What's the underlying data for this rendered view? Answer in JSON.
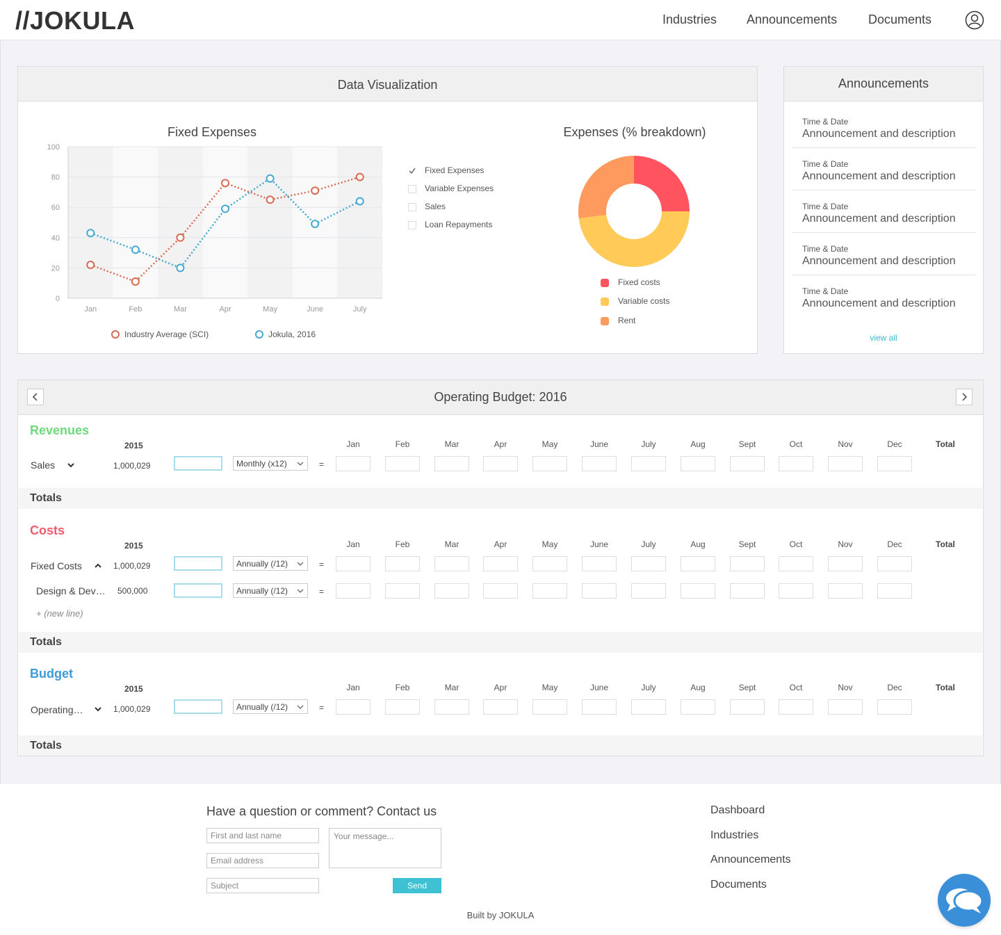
{
  "header": {
    "logo": "//JOKULA",
    "nav": [
      "Industries",
      "Announcements",
      "Documents"
    ],
    "user_icon": "user-circle-icon"
  },
  "dataviz": {
    "title": "Data Visualization",
    "line_chart": {
      "title": "Fixed Expenses",
      "legend": [
        "Industry Average (SCI)",
        "Jokula, 2016"
      ]
    },
    "filters": [
      {
        "label": "Fixed Expenses",
        "checked": true
      },
      {
        "label": "Variable Expenses",
        "checked": false
      },
      {
        "label": "Sales",
        "checked": false
      },
      {
        "label": "Loan Repayments",
        "checked": false
      }
    ],
    "donut": {
      "title": "Expenses (% breakdown)",
      "legend": [
        "Fixed costs",
        "Variable costs",
        "Rent"
      ]
    }
  },
  "chart_data": [
    {
      "type": "line",
      "title": "Fixed Expenses",
      "categories": [
        "Jan",
        "Feb",
        "Mar",
        "Apr",
        "May",
        "June",
        "July"
      ],
      "ylim": [
        0,
        100
      ],
      "yticks": [
        0,
        20,
        40,
        60,
        80,
        100
      ],
      "series": [
        {
          "name": "Industry Average (SCI)",
          "color": "#d86a52",
          "values": [
            22,
            11,
            40,
            76,
            65,
            71,
            80
          ]
        },
        {
          "name": "Jokula, 2016",
          "color": "#45a9cf",
          "values": [
            43,
            32,
            20,
            59,
            79,
            49,
            64
          ]
        }
      ],
      "grid": true,
      "legend": "bottom"
    },
    {
      "type": "pie",
      "title": "Expenses (% breakdown)",
      "labels": [
        "Fixed costs",
        "Variable costs",
        "Rent"
      ],
      "values": [
        25,
        48,
        27
      ],
      "colors": [
        "#ff5460",
        "#ffca58",
        "#ff9a5e"
      ],
      "legend": "bottom"
    }
  ],
  "announcements": {
    "title": "Announcements",
    "items": [
      {
        "time": "Time & Date",
        "desc": "Announcement and description"
      },
      {
        "time": "Time & Date",
        "desc": "Announcement and description"
      },
      {
        "time": "Time & Date",
        "desc": "Announcement and description"
      },
      {
        "time": "Time & Date",
        "desc": "Announcement and description"
      },
      {
        "time": "Time & Date",
        "desc": "Announcement and description"
      }
    ],
    "view_all": "view all"
  },
  "budget": {
    "title": "Operating Budget: 2016",
    "prev_icon": "chevron-left-icon",
    "next_icon": "chevron-right-icon",
    "months": [
      "Jan",
      "Feb",
      "Mar",
      "Apr",
      "May",
      "June",
      "July",
      "Aug",
      "Sept",
      "Oct",
      "Nov",
      "Dec"
    ],
    "total_label": "Total",
    "year": "2015",
    "totals_label": "Totals",
    "equals": "=",
    "sections": [
      {
        "title": "Revenues",
        "color": "#6ed97a",
        "rows": [
          {
            "name": "Sales",
            "value": "1,000,029",
            "freq": "Monthly (x12)"
          }
        ]
      },
      {
        "title": "Costs",
        "color": "#ef5b6b",
        "rows": [
          {
            "name": "Fixed Costs",
            "value": "1,000,029",
            "freq": "Annually (/12)"
          },
          {
            "name": "Design & Dev…",
            "value": "500,000",
            "freq": "Annually (/12)"
          }
        ],
        "new_line": "+ (new line)"
      },
      {
        "title": "Budget",
        "color": "#3e9ad8",
        "rows": [
          {
            "name": "Operating…",
            "value": "1,000,029",
            "freq": "Annually (/12)"
          }
        ]
      }
    ]
  },
  "footer": {
    "contact_title": "Have a question or comment? Contact us",
    "name_placeholder": "First and last name",
    "email_placeholder": "Email address",
    "subject_placeholder": "Subject",
    "message_placeholder": "Your message...",
    "send": "Send",
    "links": [
      "Dashboard",
      "Industries",
      "Announcements",
      "Documents"
    ],
    "built_by": "Built by JOKULA",
    "chat_icon": "chat-bubbles-icon"
  }
}
